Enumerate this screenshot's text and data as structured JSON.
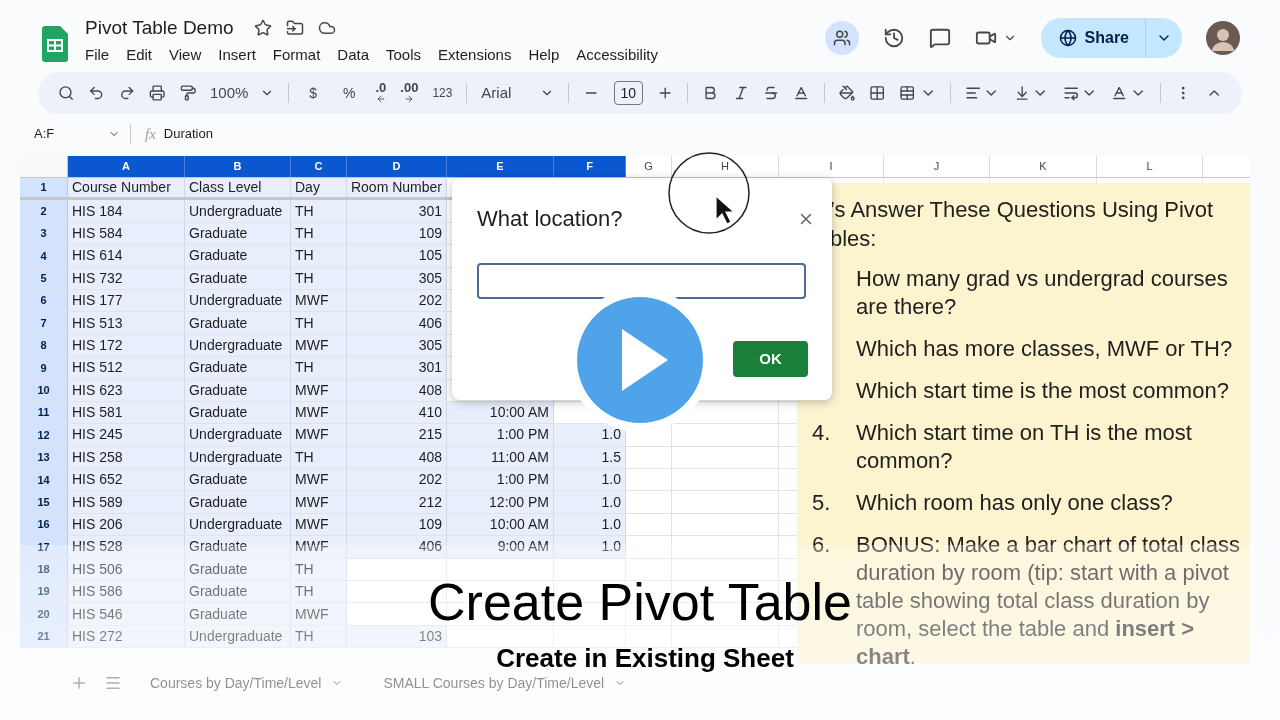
{
  "document": {
    "title": "Pivot Table Demo"
  },
  "menu": [
    "File",
    "Edit",
    "View",
    "Insert",
    "Format",
    "Data",
    "Tools",
    "Extensions",
    "Help",
    "Accessibility"
  ],
  "share_button": "Share",
  "toolbar": {
    "zoom": "100%",
    "currency": "$",
    "percent": "%",
    "decrease_decimal": ".0",
    "increase_decimal": ".00",
    "number_format": "123",
    "font": "Arial",
    "font_size": "10"
  },
  "name_box": "A:F",
  "formula_label": "fx",
  "formula": "Duration",
  "columns": [
    {
      "label": "A",
      "selected": true
    },
    {
      "label": "B",
      "selected": true
    },
    {
      "label": "C",
      "selected": true
    },
    {
      "label": "D",
      "selected": true
    },
    {
      "label": "E",
      "selected": true
    },
    {
      "label": "F",
      "selected": true
    },
    {
      "label": "G",
      "selected": false
    },
    {
      "label": "H",
      "selected": false
    },
    {
      "label": "I",
      "selected": false
    },
    {
      "label": "J",
      "selected": false
    },
    {
      "label": "K",
      "selected": false
    },
    {
      "label": "L",
      "selected": false
    }
  ],
  "rows": [
    {
      "number": "1",
      "cells": {
        "A": "Course Number",
        "B": "Class Level",
        "C": "Day",
        "D": "Room Number"
      }
    },
    {
      "number": "2",
      "cells": {
        "A": "HIS 184",
        "B": "Undergraduate",
        "C": "TH",
        "D": "301"
      }
    },
    {
      "number": "3",
      "cells": {
        "A": "HIS 584",
        "B": "Graduate",
        "C": "TH",
        "D": "109"
      }
    },
    {
      "number": "4",
      "cells": {
        "A": "HIS 614",
        "B": "Graduate",
        "C": "TH",
        "D": "105"
      }
    },
    {
      "number": "5",
      "cells": {
        "A": "HIS 732",
        "B": "Graduate",
        "C": "TH",
        "D": "305"
      }
    },
    {
      "number": "6",
      "cells": {
        "A": "HIS 177",
        "B": "Undergraduate",
        "C": "MWF",
        "D": "202"
      }
    },
    {
      "number": "7",
      "cells": {
        "A": "HIS 513",
        "B": "Graduate",
        "C": "TH",
        "D": "406"
      }
    },
    {
      "number": "8",
      "cells": {
        "A": "HIS 172",
        "B": "Undergraduate",
        "C": "MWF",
        "D": "305"
      }
    },
    {
      "number": "9",
      "cells": {
        "A": "HIS 512",
        "B": "Graduate",
        "C": "TH",
        "D": "301"
      }
    },
    {
      "number": "10",
      "cells": {
        "A": "HIS 623",
        "B": "Graduate",
        "C": "MWF",
        "D": "408"
      }
    },
    {
      "number": "11",
      "cells": {
        "A": "HIS 581",
        "B": "Graduate",
        "C": "MWF",
        "D": "410",
        "E": "10:00 AM"
      }
    },
    {
      "number": "12",
      "cells": {
        "A": "HIS 245",
        "B": "Undergraduate",
        "C": "MWF",
        "D": "215",
        "E": "1:00 PM",
        "F": "1.0"
      }
    },
    {
      "number": "13",
      "cells": {
        "A": "HIS 258",
        "B": "Undergraduate",
        "C": "TH",
        "D": "408",
        "E": "11:00 AM",
        "F": "1.5"
      }
    },
    {
      "number": "14",
      "cells": {
        "A": "HIS 652",
        "B": "Graduate",
        "C": "MWF",
        "D": "202",
        "E": "1:00 PM",
        "F": "1.0"
      }
    },
    {
      "number": "15",
      "cells": {
        "A": "HIS 589",
        "B": "Graduate",
        "C": "MWF",
        "D": "212",
        "E": "12:00 PM",
        "F": "1.0"
      }
    },
    {
      "number": "16",
      "cells": {
        "A": "HIS 206",
        "B": "Undergraduate",
        "C": "MWF",
        "D": "109",
        "E": "10:00 AM",
        "F": "1.0"
      }
    },
    {
      "number": "17",
      "cells": {
        "A": "HIS 528",
        "B": "Graduate",
        "C": "MWF",
        "D": "406",
        "E": "9:00 AM",
        "F": "1.0"
      }
    },
    {
      "number": "18",
      "cells": {
        "A": "HIS 506",
        "B": "Graduate",
        "C": "TH"
      }
    },
    {
      "number": "19",
      "cells": {
        "A": "HIS 586",
        "B": "Graduate",
        "C": "TH"
      }
    },
    {
      "number": "20",
      "cells": {
        "A": "HIS 546",
        "B": "Graduate",
        "C": "MWF"
      }
    },
    {
      "number": "21",
      "cells": {
        "A": "HIS 272",
        "B": "Undergraduate",
        "C": "TH",
        "D": "103"
      }
    }
  ],
  "dialog": {
    "title": "What location?",
    "ok_button": "OK"
  },
  "notes": {
    "heading": "’s Answer These Questions Using Pivot bles:",
    "items": [
      {
        "text": "How many grad vs undergrad courses are there?"
      },
      {
        "text": "Which has more classes,  MWF or TH?"
      },
      {
        "text": "Which start time is the most common?"
      },
      {
        "number": "4.",
        "text": "Which start time on TH is the most common?"
      },
      {
        "number": "5.",
        "text": "Which room has only one class?"
      },
      {
        "number": "6.",
        "text": "BONUS:  Make a bar chart of total class duration by room (tip: start with a pivot table showing total class duration by room, select the table and **insert > chart**."
      }
    ]
  },
  "sheet_tabs": [
    {
      "label": "Courses by Day/Time/Level",
      "selected": false
    },
    {
      "label": "SMALL Courses by Day/Time/Level",
      "selected": false
    }
  ],
  "video": {
    "title": "Create Pivot Table",
    "subtitle": "Create in Existing Sheet"
  }
}
